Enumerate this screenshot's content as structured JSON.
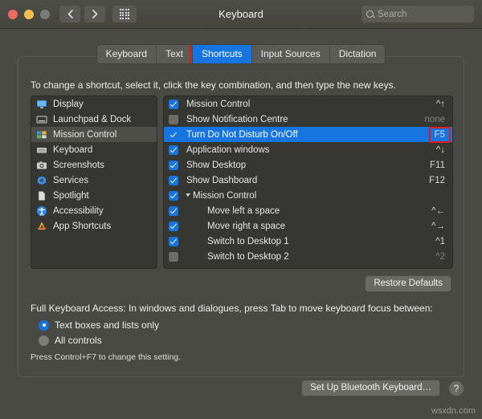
{
  "window": {
    "title": "Keyboard",
    "traffic_lights": [
      "close-red",
      "minimize-yellow",
      "zoom-disabled"
    ],
    "back_label": "‹",
    "forward_label": "›",
    "grid_icon": "grid-icon"
  },
  "search": {
    "placeholder": "Search",
    "value": "",
    "icon": "search-icon"
  },
  "tabs": [
    {
      "label": "Keyboard",
      "selected": false
    },
    {
      "label": "Text",
      "selected": false
    },
    {
      "label": "Shortcuts",
      "selected": true,
      "annotated": true
    },
    {
      "label": "Input Sources",
      "selected": false
    },
    {
      "label": "Dictation",
      "selected": false
    }
  ],
  "instructions": "To change a shortcut, select it, click the key combination, and then type the new keys.",
  "sidebar": {
    "items": [
      {
        "label": "Display",
        "icon": "display-icon",
        "selected": false
      },
      {
        "label": "Launchpad & Dock",
        "icon": "launchpad-icon",
        "selected": false
      },
      {
        "label": "Mission Control",
        "icon": "mission-control-icon",
        "selected": true
      },
      {
        "label": "Keyboard",
        "icon": "keyboard-icon",
        "selected": false
      },
      {
        "label": "Screenshots",
        "icon": "screenshots-icon",
        "selected": false
      },
      {
        "label": "Services",
        "icon": "services-gear-icon",
        "selected": false
      },
      {
        "label": "Spotlight",
        "icon": "spotlight-icon",
        "selected": false
      },
      {
        "label": "Accessibility",
        "icon": "accessibility-icon",
        "selected": false
      },
      {
        "label": "App Shortcuts",
        "icon": "app-shortcuts-icon",
        "selected": false
      }
    ]
  },
  "shortcuts": [
    {
      "label": "Mission Control",
      "key": "^↑",
      "checked": true,
      "selected": false,
      "indent": 0,
      "group": false,
      "dim": false
    },
    {
      "label": "Show Notification Centre",
      "key": "none",
      "checked": false,
      "selected": false,
      "indent": 0,
      "group": false,
      "dim": true
    },
    {
      "label": "Turn Do Not Disturb On/Off",
      "key": "F5",
      "checked": true,
      "selected": true,
      "indent": 0,
      "group": false,
      "dim": false,
      "annotated": true
    },
    {
      "label": "Application windows",
      "key": "^↓",
      "checked": true,
      "selected": false,
      "indent": 0,
      "group": false,
      "dim": false
    },
    {
      "label": "Show Desktop",
      "key": "F11",
      "checked": true,
      "selected": false,
      "indent": 0,
      "group": false,
      "dim": false
    },
    {
      "label": "Show Dashboard",
      "key": "F12",
      "checked": true,
      "selected": false,
      "indent": 0,
      "group": false,
      "dim": false
    },
    {
      "label": "Mission Control",
      "key": "",
      "checked": true,
      "selected": false,
      "indent": 0,
      "group": true,
      "dim": false
    },
    {
      "label": "Move left a space",
      "key": "^←",
      "checked": true,
      "selected": false,
      "indent": 1,
      "group": false,
      "dim": false
    },
    {
      "label": "Move right a space",
      "key": "^→",
      "checked": true,
      "selected": false,
      "indent": 1,
      "group": false,
      "dim": false
    },
    {
      "label": "Switch to Desktop 1",
      "key": "^1",
      "checked": true,
      "selected": false,
      "indent": 1,
      "group": false,
      "dim": false
    },
    {
      "label": "Switch to Desktop 2",
      "key": "^2",
      "checked": false,
      "selected": false,
      "indent": 1,
      "group": false,
      "dim": true
    }
  ],
  "buttons": {
    "restore_defaults": "Restore Defaults",
    "set_up_bluetooth_keyboard": "Set Up Bluetooth Keyboard…",
    "help": "?"
  },
  "full_keyboard_access": {
    "title": "Full Keyboard Access: In windows and dialogues, press Tab to move keyboard focus between:",
    "options": [
      {
        "label": "Text boxes and lists only",
        "selected": true
      },
      {
        "label": "All controls",
        "selected": false
      }
    ],
    "hint": "Press Control+F7 to change this setting."
  },
  "watermark": "wsxdn.com",
  "colors": {
    "accent_blue": "#1675e0",
    "annotation_red": "#e01b1b",
    "window_bg": "#4a4a45",
    "list_bg": "#363632"
  }
}
